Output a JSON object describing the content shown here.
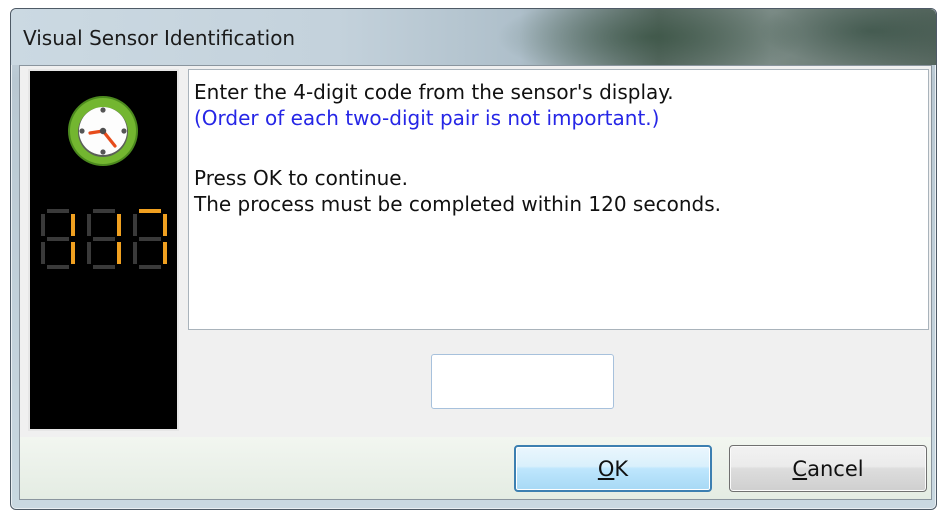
{
  "window": {
    "title": "Visual Sensor Identification"
  },
  "sensor_panel": {
    "digit_display": "117",
    "clock_icon": "clock-icon"
  },
  "message": {
    "line1": "Enter the 4-digit code from the sensor's display.",
    "line2": "(Order of each two-digit pair is not important.)",
    "line3": "Press OK to continue.",
    "line4": "The process must be completed within 120 seconds."
  },
  "code_input": {
    "value": "",
    "placeholder": ""
  },
  "buttons": {
    "ok": {
      "mnemonic": "O",
      "rest": "K"
    },
    "cancel": {
      "mnemonic": "C",
      "rest": "ancel"
    }
  },
  "colors": {
    "accent_text": "#2626e6",
    "digit_on": "#f0a020",
    "digit_off": "#3a3a3a",
    "clock_face": "#6fae2a"
  }
}
